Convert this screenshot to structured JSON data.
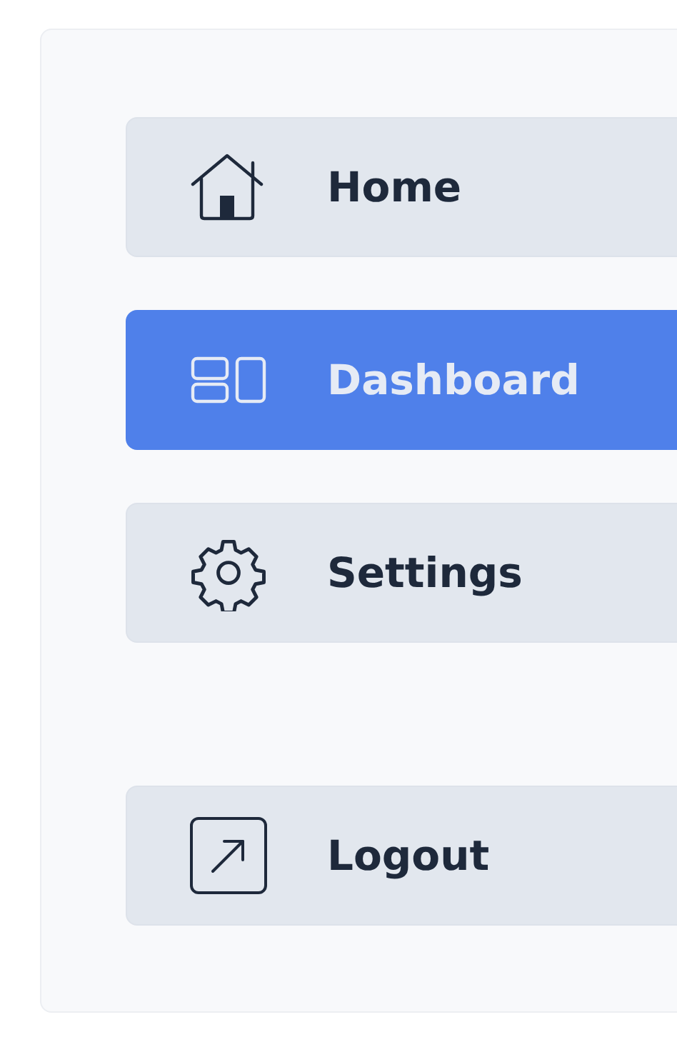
{
  "sidebar": {
    "items": [
      {
        "label": "Home",
        "selected": false
      },
      {
        "label": "Dashboard",
        "selected": true
      },
      {
        "label": "Settings",
        "selected": false
      }
    ],
    "bottom_items": [
      {
        "label": "Logout",
        "selected": false
      }
    ]
  }
}
